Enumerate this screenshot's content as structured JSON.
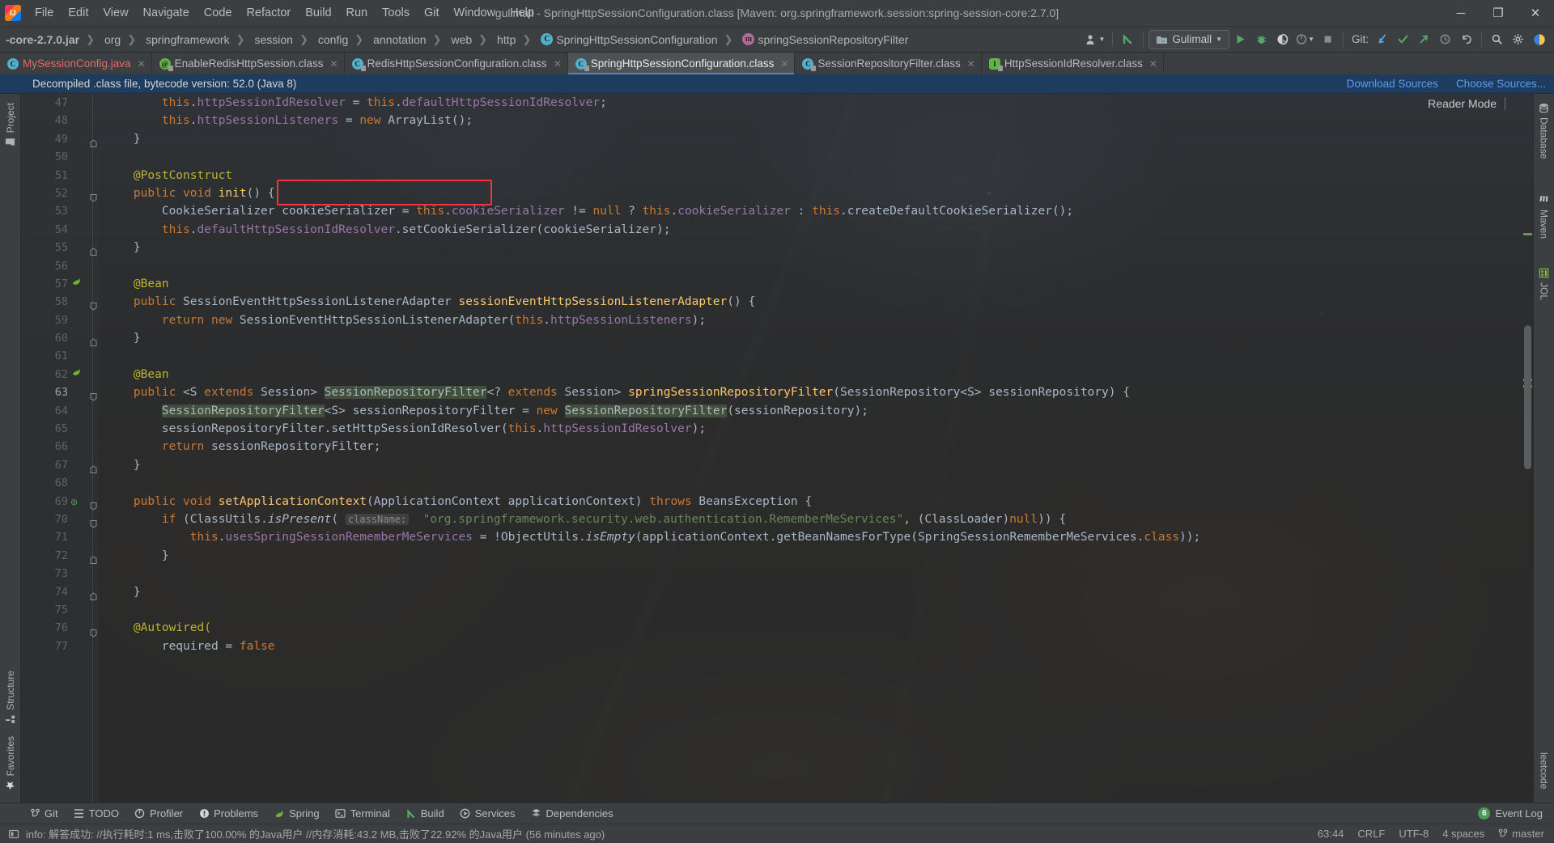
{
  "window": {
    "title": "gulimall - SpringHttpSessionConfiguration.class [Maven: org.springframework.session:spring-session-core:2.7.0]",
    "minimize": "─",
    "maximize": "❐",
    "close": "✕"
  },
  "menu": [
    {
      "label": "File"
    },
    {
      "label": "Edit"
    },
    {
      "label": "View"
    },
    {
      "label": "Navigate"
    },
    {
      "label": "Code"
    },
    {
      "label": "Refactor"
    },
    {
      "label": "Build"
    },
    {
      "label": "Run"
    },
    {
      "label": "Tools"
    },
    {
      "label": "Git"
    },
    {
      "label": "Window"
    },
    {
      "label": "Help"
    }
  ],
  "breadcrumbs": [
    {
      "label": "-core-2.7.0.jar",
      "icon": "jar-icon"
    },
    {
      "label": "org",
      "icon": "package-icon"
    },
    {
      "label": "springframework",
      "icon": "package-icon"
    },
    {
      "label": "session",
      "icon": "package-icon"
    },
    {
      "label": "config",
      "icon": "package-icon"
    },
    {
      "label": "annotation",
      "icon": "package-icon"
    },
    {
      "label": "web",
      "icon": "package-icon"
    },
    {
      "label": "http",
      "icon": "package-icon"
    },
    {
      "label": "SpringHttpSessionConfiguration",
      "icon": "class-icon"
    },
    {
      "label": "springSessionRepositoryFilter",
      "icon": "method-icon"
    }
  ],
  "toolbar": {
    "run_config": "Gulimall",
    "git_label": "Git:",
    "icons": [
      {
        "name": "user-avatar-icon",
        "glyph": "👤"
      },
      {
        "name": "update-project-icon",
        "glyph": "↖"
      },
      {
        "name": "run-icon",
        "glyph": "▶"
      },
      {
        "name": "debug-icon",
        "glyph": "🐞"
      },
      {
        "name": "run-with-coverage-icon",
        "glyph": "◑"
      },
      {
        "name": "profiler-icon",
        "glyph": "◴"
      },
      {
        "name": "stop-icon",
        "glyph": "■"
      },
      {
        "name": "git-update-icon",
        "glyph": "↙"
      },
      {
        "name": "git-commit-icon",
        "glyph": "✓"
      },
      {
        "name": "git-push-icon",
        "glyph": "↗"
      },
      {
        "name": "git-history-icon",
        "glyph": "◷"
      },
      {
        "name": "git-rollback-icon",
        "glyph": "↺"
      },
      {
        "name": "search-everywhere-icon",
        "glyph": "🔍"
      },
      {
        "name": "settings-icon",
        "glyph": "⚙"
      }
    ]
  },
  "tabs": [
    {
      "label": "MySessionConfig.java",
      "icon": "java-class-icon",
      "active": false,
      "red": true
    },
    {
      "label": "EnableRedisHttpSession.class",
      "icon": "annotation-icon",
      "active": false,
      "red": false
    },
    {
      "label": "RedisHttpSessionConfiguration.class",
      "icon": "class-decompiled-icon",
      "active": false,
      "red": false
    },
    {
      "label": "SpringHttpSessionConfiguration.class",
      "icon": "class-decompiled-icon",
      "active": true,
      "red": false
    },
    {
      "label": "SessionRepositoryFilter.class",
      "icon": "class-decompiled-icon",
      "active": false,
      "red": false
    },
    {
      "label": "HttpSessionIdResolver.class",
      "icon": "interface-decompiled-icon",
      "active": false,
      "red": false
    }
  ],
  "notification": {
    "message": "Decompiled .class file, bytecode version: 52.0 (Java 8)",
    "download_sources": "Download Sources",
    "choose_sources": "Choose Sources..."
  },
  "editor": {
    "reader_mode": "Reader Mode",
    "current_line": 63,
    "lines": [
      {
        "n": 47,
        "indent": 0,
        "text": "        this.httpSessionIdResolver = this.defaultHttpSessionIdResolver;"
      },
      {
        "n": 48,
        "indent": 0,
        "text": "        this.httpSessionListeners = new ArrayList();"
      },
      {
        "n": 49,
        "indent": 0,
        "text": "    }"
      },
      {
        "n": 50,
        "indent": 0,
        "text": ""
      },
      {
        "n": 51,
        "indent": 0,
        "text": "    @PostConstruct"
      },
      {
        "n": 52,
        "indent": 0,
        "text": "    public void init() {"
      },
      {
        "n": 53,
        "indent": 0,
        "text": "        CookieSerializer cookieSerializer = this.cookieSerializer != null ? this.cookieSerializer : this.createDefaultCookieSerializer();"
      },
      {
        "n": 54,
        "indent": 0,
        "text": "        this.defaultHttpSessionIdResolver.setCookieSerializer(cookieSerializer);"
      },
      {
        "n": 55,
        "indent": 0,
        "text": "    }"
      },
      {
        "n": 56,
        "indent": 0,
        "text": ""
      },
      {
        "n": 57,
        "indent": 0,
        "text": "    @Bean"
      },
      {
        "n": 58,
        "indent": 0,
        "text": "    public SessionEventHttpSessionListenerAdapter sessionEventHttpSessionListenerAdapter() {"
      },
      {
        "n": 59,
        "indent": 0,
        "text": "        return new SessionEventHttpSessionListenerAdapter(this.httpSessionListeners);"
      },
      {
        "n": 60,
        "indent": 0,
        "text": "    }"
      },
      {
        "n": 61,
        "indent": 0,
        "text": ""
      },
      {
        "n": 62,
        "indent": 0,
        "text": "    @Bean"
      },
      {
        "n": 63,
        "indent": 0,
        "text": "    public <S extends Session> SessionRepositoryFilter<? extends Session> springSessionRepositoryFilter(SessionRepository<S> sessionRepository) {"
      },
      {
        "n": 64,
        "indent": 0,
        "text": "        SessionRepositoryFilter<S> sessionRepositoryFilter = new SessionRepositoryFilter(sessionRepository);"
      },
      {
        "n": 65,
        "indent": 0,
        "text": "        sessionRepositoryFilter.setHttpSessionIdResolver(this.httpSessionIdResolver);"
      },
      {
        "n": 66,
        "indent": 0,
        "text": "        return sessionRepositoryFilter;"
      },
      {
        "n": 67,
        "indent": 0,
        "text": "    }"
      },
      {
        "n": 68,
        "indent": 0,
        "text": ""
      },
      {
        "n": 69,
        "indent": 0,
        "text": "    public void setApplicationContext(ApplicationContext applicationContext) throws BeansException {"
      },
      {
        "n": 70,
        "indent": 0,
        "text": "        if (ClassUtils.isPresent( className: \"org.springframework.security.web.authentication.RememberMeServices\", (ClassLoader)null)) {"
      },
      {
        "n": 71,
        "indent": 0,
        "text": "            this.usesSpringSessionRememberMeServices = !ObjectUtils.isEmpty(applicationContext.getBeanNamesForType(SpringSessionRememberMeServices.class));"
      },
      {
        "n": 72,
        "indent": 0,
        "text": "        }"
      },
      {
        "n": 73,
        "indent": 0,
        "text": ""
      },
      {
        "n": 74,
        "indent": 0,
        "text": "    }"
      },
      {
        "n": 75,
        "indent": 0,
        "text": ""
      },
      {
        "n": 76,
        "indent": 0,
        "text": "    @Autowired("
      },
      {
        "n": 77,
        "indent": 0,
        "text": "        required = false"
      }
    ],
    "param_hint": "className:"
  },
  "left_toolwindows": [
    {
      "label": "Project",
      "icon": "project-folder-icon"
    },
    {
      "label": "Structure",
      "icon": "structure-icon"
    },
    {
      "label": "Favorites",
      "icon": "star-icon"
    }
  ],
  "right_toolwindows": [
    {
      "label": "Database",
      "icon": "database-icon"
    },
    {
      "label": "Maven",
      "icon": "maven-m-icon"
    },
    {
      "label": "JOL",
      "icon": "jol-grid-icon"
    },
    {
      "label": "leetcode",
      "icon": "leetcode-icon"
    }
  ],
  "bottom_toolwindows": [
    {
      "label": "Git",
      "icon": "git-branch-icon"
    },
    {
      "label": "TODO",
      "icon": "todo-list-icon"
    },
    {
      "label": "Profiler",
      "icon": "profiler-icon"
    },
    {
      "label": "Problems",
      "icon": "problems-icon"
    },
    {
      "label": "Spring",
      "icon": "spring-leaf-icon"
    },
    {
      "label": "Terminal",
      "icon": "terminal-icon"
    },
    {
      "label": "Build",
      "icon": "build-hammer-icon"
    },
    {
      "label": "Services",
      "icon": "services-icon"
    },
    {
      "label": "Dependencies",
      "icon": "dependencies-icon"
    }
  ],
  "event_log": {
    "count": "6",
    "label": "Event Log"
  },
  "statusbar": {
    "message": "info: 解答成功: //执行耗时:1 ms,击败了100.00% 的Java用户 //内存消耗:43.2 MB,击败了22.92% 的Java用户 (56 minutes ago)",
    "caret": "63:44",
    "line_separator": "CRLF",
    "encoding": "UTF-8",
    "indent": "4 spaces",
    "branch": "master"
  },
  "colors": {
    "accent": "#4a88c7",
    "link": "#589df6",
    "notification_bg": "#1d3c5e",
    "highlight_box": "#f5333f",
    "usage_highlight": "#556e48",
    "panel": "#3c3f41",
    "editor_bg": "#2b2b2b"
  }
}
